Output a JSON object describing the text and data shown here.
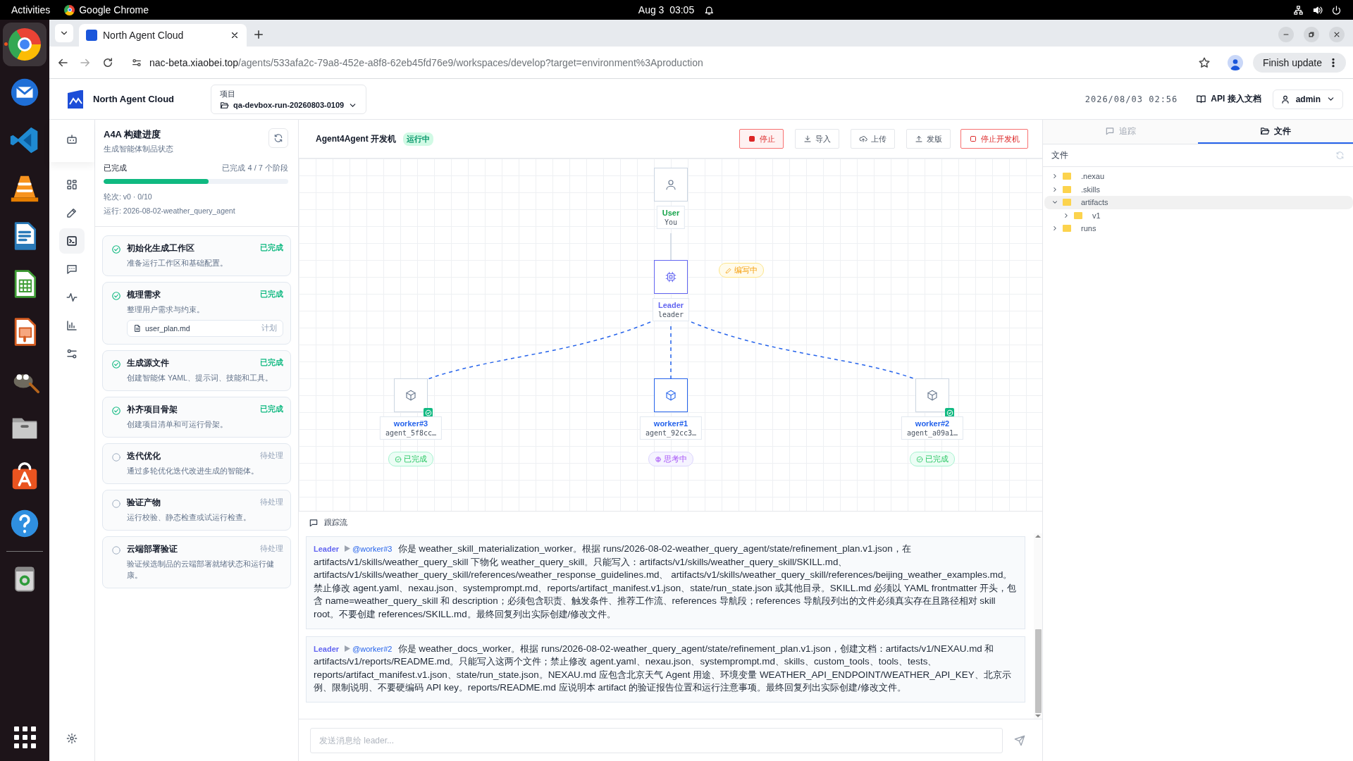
{
  "os_bar": {
    "activities": "Activities",
    "app": "Google Chrome",
    "clock": "Aug 3  03:05"
  },
  "dock": {
    "apps": [
      {
        "kind": "chrome",
        "running": true
      },
      {
        "kind": "mail",
        "running": false
      },
      {
        "kind": "code",
        "running": false
      },
      {
        "kind": "cone",
        "running": false
      },
      {
        "kind": "writer",
        "running": false
      },
      {
        "kind": "calc",
        "running": false
      },
      {
        "kind": "impress",
        "running": false
      },
      {
        "kind": "gimp",
        "running": false
      },
      {
        "kind": "files",
        "running": false
      },
      {
        "kind": "store",
        "running": false
      },
      {
        "kind": "help",
        "running": false
      },
      {
        "kind": "trash",
        "running": false
      }
    ]
  },
  "browser": {
    "tab_title": "North Agent Cloud",
    "url_host": "nac-beta.xiaobei.top",
    "url_path": "/agents/533afa2c-79a8-452e-a8f8-62eb45fd76e9/workspaces/develop?target=environment%3Aproduction",
    "update_button": "Finish update"
  },
  "header": {
    "brand": "North Agent Cloud",
    "project_label": "项目",
    "project": "qa-devbox-run-20260803-0109",
    "timestamp": "2026/08/03 02:56",
    "docs_link": "API 接入文档",
    "user": "admin"
  },
  "rail": {
    "items": [
      {
        "kind": "robot",
        "selected": false
      },
      {
        "kind": "grid",
        "selected": false
      },
      {
        "kind": "pencil",
        "selected": false
      },
      {
        "kind": "terminal",
        "selected": true
      },
      {
        "kind": "chat",
        "selected": false
      },
      {
        "kind": "activity",
        "selected": false
      },
      {
        "kind": "chart",
        "selected": false
      },
      {
        "kind": "sliders",
        "selected": false
      }
    ],
    "footer": {
      "kind": "settings"
    }
  },
  "progress": {
    "title": "A4A 构建进度",
    "subtitle": "生成智能体制品状态",
    "status": "已完成",
    "count": "已完成 4 / 7 个阶段",
    "level": 0.57,
    "round": "轮次: v0 · 0/10",
    "run": "运行: 2026-08-02-weather_query_agent",
    "stages": [
      {
        "title": "初始化生成工作区",
        "description": "准备运行工作区和基础配置。",
        "status": "已完成",
        "done": true
      },
      {
        "title": "梳理需求",
        "description": "整理用户需求与约束。",
        "status": "已完成",
        "done": true,
        "file": {
          "name": "user_plan.md",
          "tag": "计划"
        }
      },
      {
        "title": "生成源文件",
        "description": "创建智能体 YAML、提示词、技能和工具。",
        "status": "已完成",
        "done": true
      },
      {
        "title": "补齐项目骨架",
        "description": "创建项目清单和可运行骨架。",
        "status": "已完成",
        "done": true
      },
      {
        "title": "迭代优化",
        "description": "通过多轮优化迭代改进生成的智能体。",
        "status": "待处理",
        "done": false
      },
      {
        "title": "验证产物",
        "description": "运行校验、静态检查或试运行检查。",
        "status": "待处理",
        "done": false
      },
      {
        "title": "云端部署验证",
        "description": "验证候选制品的云端部署就绪状态和运行健康。",
        "status": "待处理",
        "done": false
      }
    ]
  },
  "workspace": {
    "title": "Agent4Agent 开发机",
    "status": "运行中",
    "buttons": [
      {
        "label": "停止",
        "kind": "danger-fill"
      },
      {
        "label": "导入",
        "kind": "plain"
      },
      {
        "label": "上传",
        "kind": "plain"
      },
      {
        "label": "发版",
        "kind": "plain"
      },
      {
        "label": "停止开发机",
        "kind": "danger-outline"
      }
    ],
    "graph": {
      "nodes": [
        {
          "kind": "user",
          "name": "User",
          "id": "You",
          "selected": false
        },
        {
          "kind": "leader",
          "name": "Leader",
          "id": "leader",
          "selected": true,
          "activity": "编写中"
        },
        {
          "kind": "worker",
          "name": "worker#3",
          "id": "agent_5f8cc…",
          "selected": false,
          "status": {
            "kind": "done",
            "label": "已完成"
          }
        },
        {
          "kind": "worker",
          "name": "worker#1",
          "id": "agent_92cc3…",
          "selected": true,
          "status": {
            "kind": "thinking",
            "label": "思考中"
          }
        },
        {
          "kind": "worker",
          "name": "worker#2",
          "id": "agent_a09a1…",
          "selected": false,
          "status": {
            "kind": "done",
            "label": "已完成"
          }
        }
      ]
    }
  },
  "trace": {
    "title": "跟踪流",
    "messages": [
      {
        "from": "Leader",
        "to": "@worker#3",
        "text": "你是 weather_skill_materialization_worker。根据 runs/2026-08-02-weather_query_agent/state/refinement_plan.v1.json，在 artifacts/v1/skills/weather_query_skill 下物化 weather_query_skill。只能写入：artifacts/v1/skills/weather_query_skill/SKILL.md、 artifacts/v1/skills/weather_query_skill/references/weather_response_guidelines.md、 artifacts/v1/skills/weather_query_skill/references/beijing_weather_examples.md。禁止修改 agent.yaml、nexau.json、systemprompt.md、reports/artifact_manifest.v1.json、state/run_state.json 或其他目录。SKILL.md 必须以 YAML frontmatter 开头，包含 name=weather_query_skill 和 description；必须包含职责、触发条件、推荐工作流、references 导航段；references 导航段列出的文件必须真实存在且路径相对 skill root。不要创建 references/SKILL.md。最终回复列出实际创建/修改文件。"
      },
      {
        "from": "Leader",
        "to": "@worker#2",
        "text": "你是 weather_docs_worker。根据 runs/2026-08-02-weather_query_agent/state/refinement_plan.v1.json，创建文档：artifacts/v1/NEXAU.md 和 artifacts/v1/reports/README.md。只能写入这两个文件；禁止修改 agent.yaml、nexau.json、systemprompt.md、skills、custom_tools、tools、tests、reports/artifact_manifest.v1.json、state/run_state.json。NEXAU.md 应包含北京天气 Agent 用途、环境变量 WEATHER_API_ENDPOINT/WEATHER_API_KEY、北京示例、限制说明、不要硬编码 API key。reports/README.md 应说明本 artifact 的验证报告位置和运行注意事项。最终回复列出实际创建/修改文件。"
      }
    ],
    "input": {
      "placeholder": "发送消息给 leader..."
    }
  },
  "side_panel": {
    "tabs": [
      {
        "label": "追踪",
        "kind": "trace",
        "selected": false
      },
      {
        "label": "文件",
        "kind": "files",
        "selected": true
      }
    ],
    "files_title": "文件",
    "tree": [
      {
        "name": ".nexau",
        "expanded": false,
        "selected": false
      },
      {
        "name": ".skills",
        "expanded": false,
        "selected": false
      },
      {
        "name": "artifacts",
        "expanded": true,
        "selected": true,
        "children": [
          {
            "name": "v1",
            "expanded": false,
            "selected": false
          }
        ]
      },
      {
        "name": "runs",
        "expanded": false,
        "selected": false
      }
    ]
  }
}
